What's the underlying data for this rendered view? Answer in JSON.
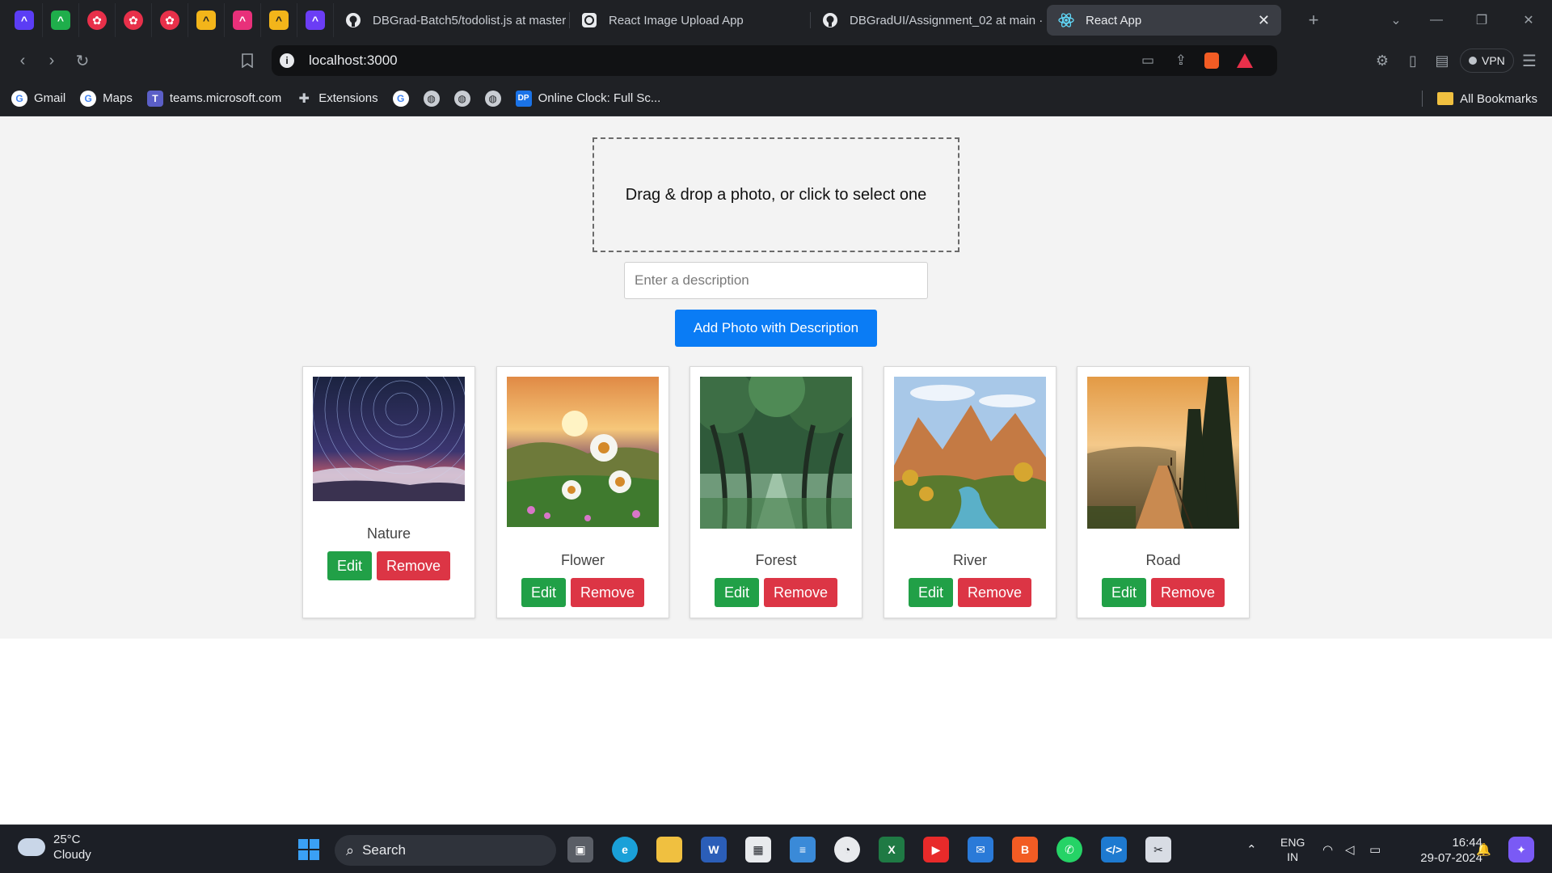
{
  "browser": {
    "pinned_tabs": [
      {
        "icon": "app-purple-icon",
        "color": "#5b3df5"
      },
      {
        "icon": "app-green-icon",
        "color": "#1fae4b"
      },
      {
        "icon": "app-red-icon",
        "color": "#e8304a"
      },
      {
        "icon": "app-red-icon",
        "color": "#e8304a"
      },
      {
        "icon": "app-red-icon",
        "color": "#e8304a"
      },
      {
        "icon": "app-yellow-icon",
        "color": "#f3b51a"
      },
      {
        "icon": "app-pink-icon",
        "color": "#e8307a"
      },
      {
        "icon": "app-yellow-icon",
        "color": "#f3b51a"
      },
      {
        "icon": "app-purple-icon",
        "color": "#6b3df5"
      }
    ],
    "tabs": [
      {
        "title": "DBGrad-Batch5/todolist.js at master"
      },
      {
        "title": "React Image Upload App"
      },
      {
        "title": "DBGradUI/Assignment_02 at main ·"
      },
      {
        "title": "React App",
        "active": true
      }
    ],
    "new_tab": "+",
    "address": "localhost:3000",
    "vpn_label": "VPN",
    "bookmarks": [
      {
        "label": "Gmail",
        "icon": "google-icon"
      },
      {
        "label": "Maps",
        "icon": "google-icon"
      },
      {
        "label": "teams.microsoft.com",
        "icon": "teams-icon"
      },
      {
        "label": "Extensions",
        "icon": "puzzle-icon"
      },
      {
        "label": "",
        "icon": "google-icon"
      },
      {
        "label": "",
        "icon": "globe-icon"
      },
      {
        "label": "",
        "icon": "globe-icon"
      },
      {
        "label": "",
        "icon": "globe-icon"
      },
      {
        "label": "Online Clock: Full Sc...",
        "icon": "dp-icon"
      }
    ],
    "all_bookmarks": "All Bookmarks"
  },
  "app": {
    "dropzone_text": "Drag & drop a photo, or click to select one",
    "description_placeholder": "Enter a description",
    "description_value": "",
    "add_button": "Add Photo with Description",
    "edit_label": "Edit",
    "remove_label": "Remove",
    "photos": [
      {
        "title": "Nature",
        "scene": "star-trails-night-sky"
      },
      {
        "title": "Flower",
        "scene": "daisies-at-sunset"
      },
      {
        "title": "Forest",
        "scene": "tree-lined-green-path"
      },
      {
        "title": "River",
        "scene": "canyon-river"
      },
      {
        "title": "Road",
        "scene": "boardwalk-in-forest-sunset"
      }
    ]
  },
  "taskbar": {
    "weather_temp": "25°C",
    "weather_text": "Cloudy",
    "search_label": "Search",
    "lang_top": "ENG",
    "lang_bottom": "IN",
    "time": "16:44",
    "date": "29-07-2024"
  },
  "colors": {
    "primary_button": "#0a7cf5",
    "edit_button": "#21a047",
    "remove_button": "#dc3545",
    "page_background": "#f3f3f3"
  }
}
